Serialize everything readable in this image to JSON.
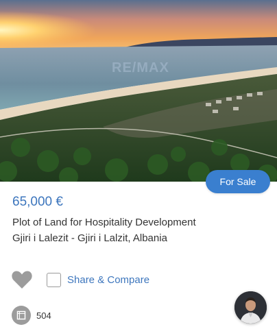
{
  "listing": {
    "watermark": "RE/MAX",
    "status_badge": "For Sale",
    "price": "65,000 €",
    "title": "Plot of Land for Hospitality Development",
    "location": "Gjiri i Lalezit - Gjiri i Lalzit, Albania",
    "area": "504"
  },
  "actions": {
    "favorite_icon": "heart-icon",
    "compare_label": "Share & Compare"
  },
  "colors": {
    "accent": "#3a7fcf",
    "price_text": "#3d76bd",
    "icon_gray": "#9c9c9c"
  }
}
